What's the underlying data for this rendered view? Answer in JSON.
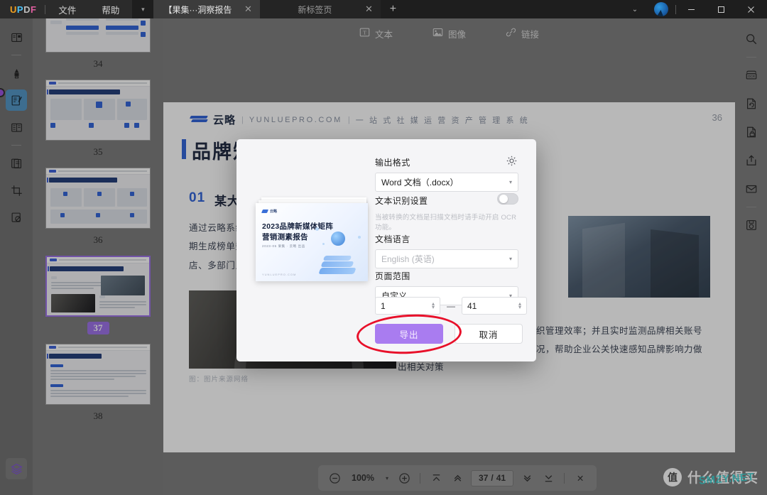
{
  "titlebar": {
    "logo": "UPDF",
    "menus": [
      "文件",
      "帮助"
    ],
    "tabs": [
      {
        "label": "【果集···洞察报告",
        "close": "✕",
        "active": true
      },
      {
        "label": "新标签页",
        "close": "✕",
        "active": false
      }
    ],
    "new_tab": "+",
    "caret": "▾",
    "chevron": "⌄",
    "minimize": "—",
    "maximize": "▢",
    "close": "✕"
  },
  "left_rail": {
    "items": [
      {
        "name": "reader-mode-icon",
        "selected": false
      },
      {
        "name": "annotate-highlight-icon",
        "selected": false
      },
      {
        "name": "edit-pdf-icon",
        "selected": true
      },
      {
        "name": "page-organize-icon",
        "selected": false
      },
      {
        "name": "form-fields-icon",
        "selected": false
      },
      {
        "name": "crop-page-icon",
        "selected": false
      },
      {
        "name": "redact-icon",
        "selected": false
      }
    ],
    "bottom_item": {
      "name": "layers-icon"
    }
  },
  "right_rail": {
    "items": [
      {
        "name": "search-icon"
      },
      {
        "name": "ocr-icon"
      },
      {
        "name": "convert-pdf-icon"
      },
      {
        "name": "protect-document-icon"
      },
      {
        "name": "share-icon"
      },
      {
        "name": "email-icon"
      },
      {
        "name": "save-icon"
      }
    ]
  },
  "toolbar": {
    "tools": [
      {
        "label": "文本",
        "icon": "text-box-icon"
      },
      {
        "label": "图像",
        "icon": "image-icon"
      },
      {
        "label": "链接",
        "icon": "link-icon"
      }
    ]
  },
  "thumbnails": {
    "pages": [
      {
        "number": "34",
        "selected": false
      },
      {
        "number": "35",
        "selected": false
      },
      {
        "number": "36",
        "selected": false
      },
      {
        "number": "37",
        "selected": true
      },
      {
        "number": "38",
        "selected": false
      }
    ]
  },
  "document": {
    "page_label": "36",
    "brand": "云略",
    "brand_separator": "|",
    "brand_url": "YUNLUEPRO.COM",
    "brand_tagline": "一 站 式 社 媒 运 营 资 产 管 理 系 统",
    "title": "品牌矩",
    "section_number": "01",
    "section_title": "某大型",
    "left_paragraph": "通过云略系统\n期生成榜单数\n店、多部门人",
    "right_paragraph": "的账号数据，提升经销商协作及组织管理效率；并且实时监测品牌相关账号的数据，及时发现品牌舆情传播情况，帮助企业公关快速感知品牌影响力做出相关对策",
    "caption": "图：图片来源网络"
  },
  "dialog": {
    "preview": {
      "logo_text": "云略",
      "title_line1": "2023品牌新媒体矩阵",
      "title_line2": "营销测素报告",
      "date_line": "2023-05 果集 · 云略 出品",
      "url": "YUNLUEPRO.COM"
    },
    "output_format": {
      "label": "输出格式",
      "value": "Word 文档（.docx）",
      "caret": "▾",
      "gear_icon": "gear-icon"
    },
    "ocr": {
      "label": "文本识别设置",
      "enabled": false,
      "hint": "当被转换的文档是扫描文档时请手动开启 OCR 功能。"
    },
    "doc_language": {
      "label": "文档语言",
      "value": "English (英语)",
      "caret": "▾"
    },
    "page_range": {
      "label": "页面范围",
      "value": "自定义",
      "caret": "▾",
      "from": "1",
      "to": "41",
      "separator": "—"
    },
    "buttons": {
      "export": "导出",
      "cancel": "取消"
    },
    "accent_color": "#a97cf0",
    "annotation_color": "#e8102a"
  },
  "bottombar": {
    "zoom_out": "−",
    "zoom_level": "100%",
    "zoom_caret": "▾",
    "zoom_in": "+",
    "fit_top_icon": "scroll-to-top-icon",
    "prev_page_icon": "previous-page-icon",
    "page_current": "37",
    "page_sep": "/",
    "page_total": "41",
    "next_page_icon": "next-page-icon",
    "last_page_icon": "scroll-to-bottom-icon",
    "close_icon": "✕"
  },
  "watermark": {
    "badge": "值",
    "text": "什么值得买",
    "overlay": "SMZY.NET"
  }
}
